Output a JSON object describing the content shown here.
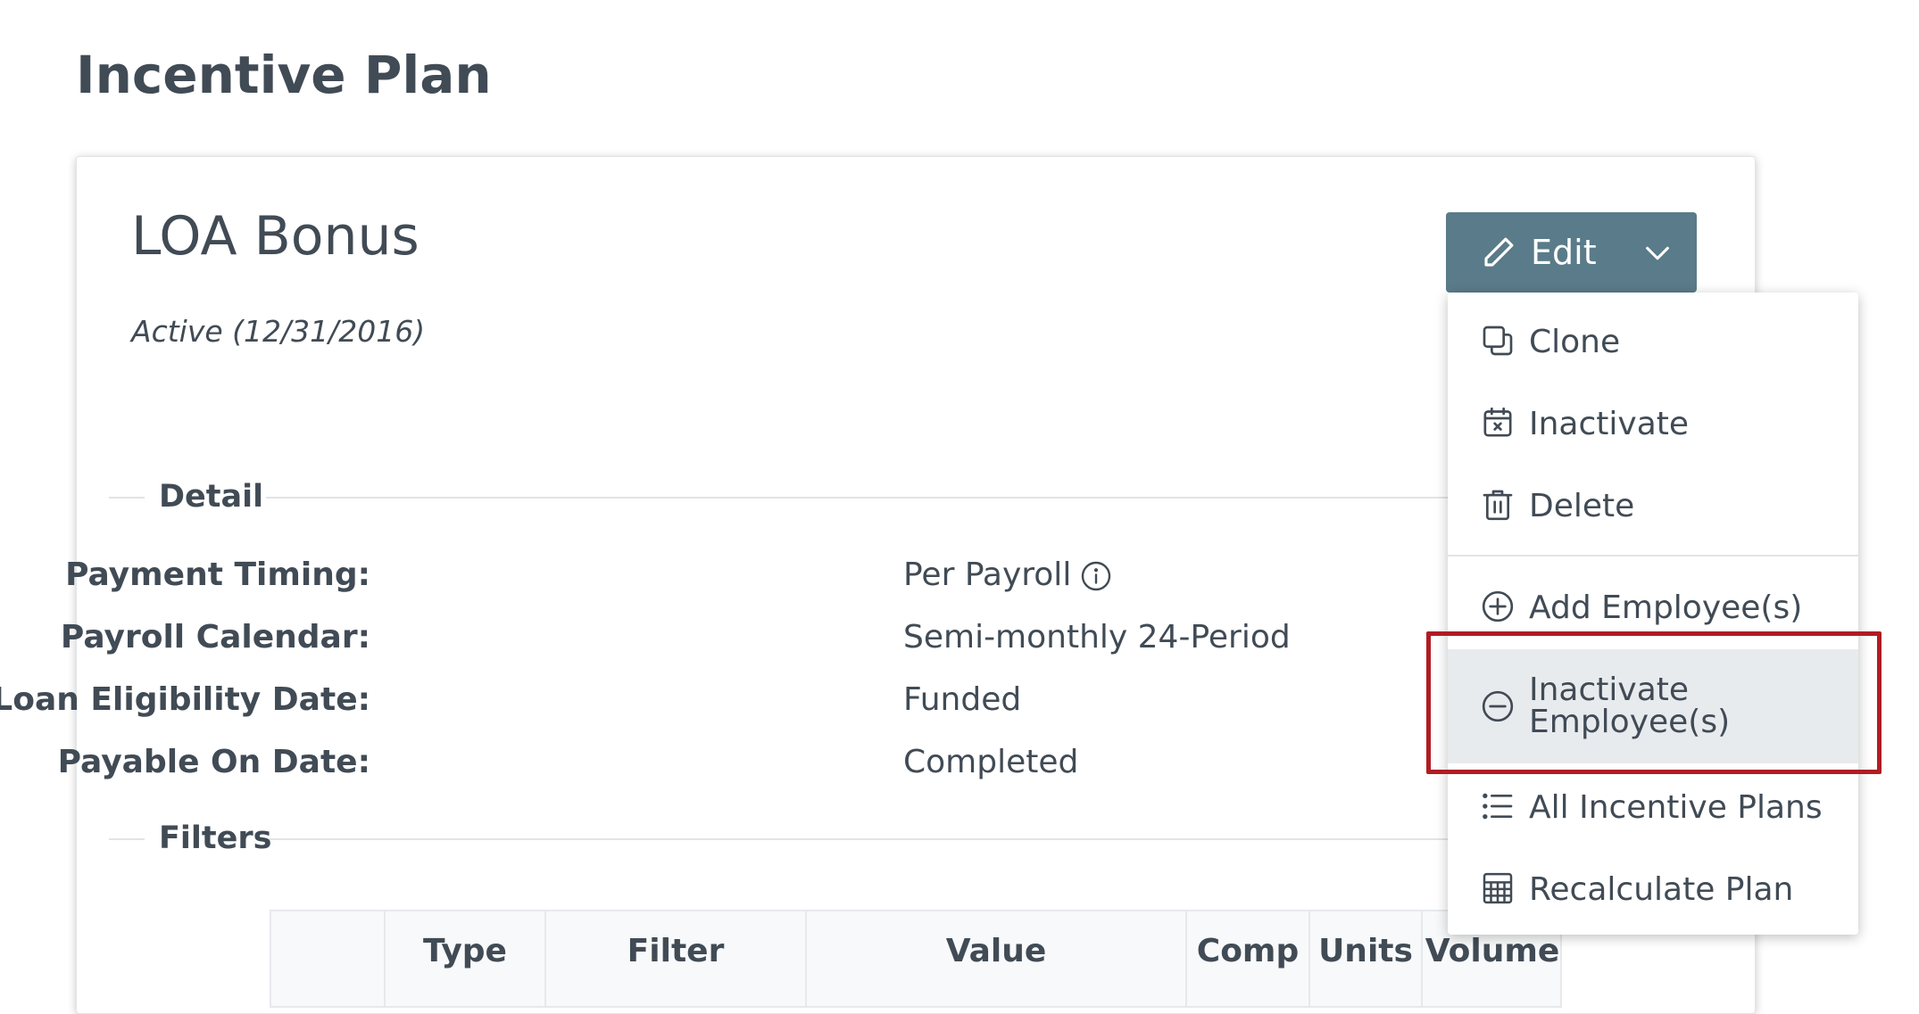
{
  "page": {
    "title": "Incentive Plan"
  },
  "plan": {
    "name": "LOA Bonus",
    "status": "Active (12/31/2016)"
  },
  "edit_button": {
    "label": "Edit",
    "icon": "pencil-icon",
    "dropdown_icon": "chevron-down-icon"
  },
  "sections": {
    "detail": "Detail",
    "filters": "Filters"
  },
  "detail": [
    {
      "label": "Payment Timing:",
      "value": "Per Payroll",
      "has_info_icon": true
    },
    {
      "label": "Payroll Calendar:",
      "value": "Semi-monthly 24-Period"
    },
    {
      "label": "Loan Eligibility Date:",
      "value": "Funded"
    },
    {
      "label": "Payable On Date:",
      "value": "Completed"
    }
  ],
  "filters_table": {
    "columns": [
      "",
      "Type",
      "Filter",
      "Value",
      "Comp",
      "Units",
      "Volume"
    ]
  },
  "menu": {
    "items": [
      {
        "label": "Clone",
        "icon": "clone-icon"
      },
      {
        "label": "Inactivate",
        "icon": "calendar-x-icon"
      },
      {
        "label": "Delete",
        "icon": "trash-icon"
      },
      {
        "label": "Add Employee(s)",
        "icon": "plus-circle-icon"
      },
      {
        "label_line1": "Inactivate",
        "label_line2": "Employee(s)",
        "icon": "minus-circle-icon",
        "highlighted": true
      },
      {
        "label": "All Incentive Plans",
        "icon": "list-icon"
      },
      {
        "label": "Recalculate Plan",
        "icon": "calculator-icon"
      }
    ]
  },
  "colors": {
    "text": "#414b55",
    "button_bg": "#5a7b89",
    "highlight_border": "#b01c24",
    "active_item_bg": "#e8ebee"
  }
}
